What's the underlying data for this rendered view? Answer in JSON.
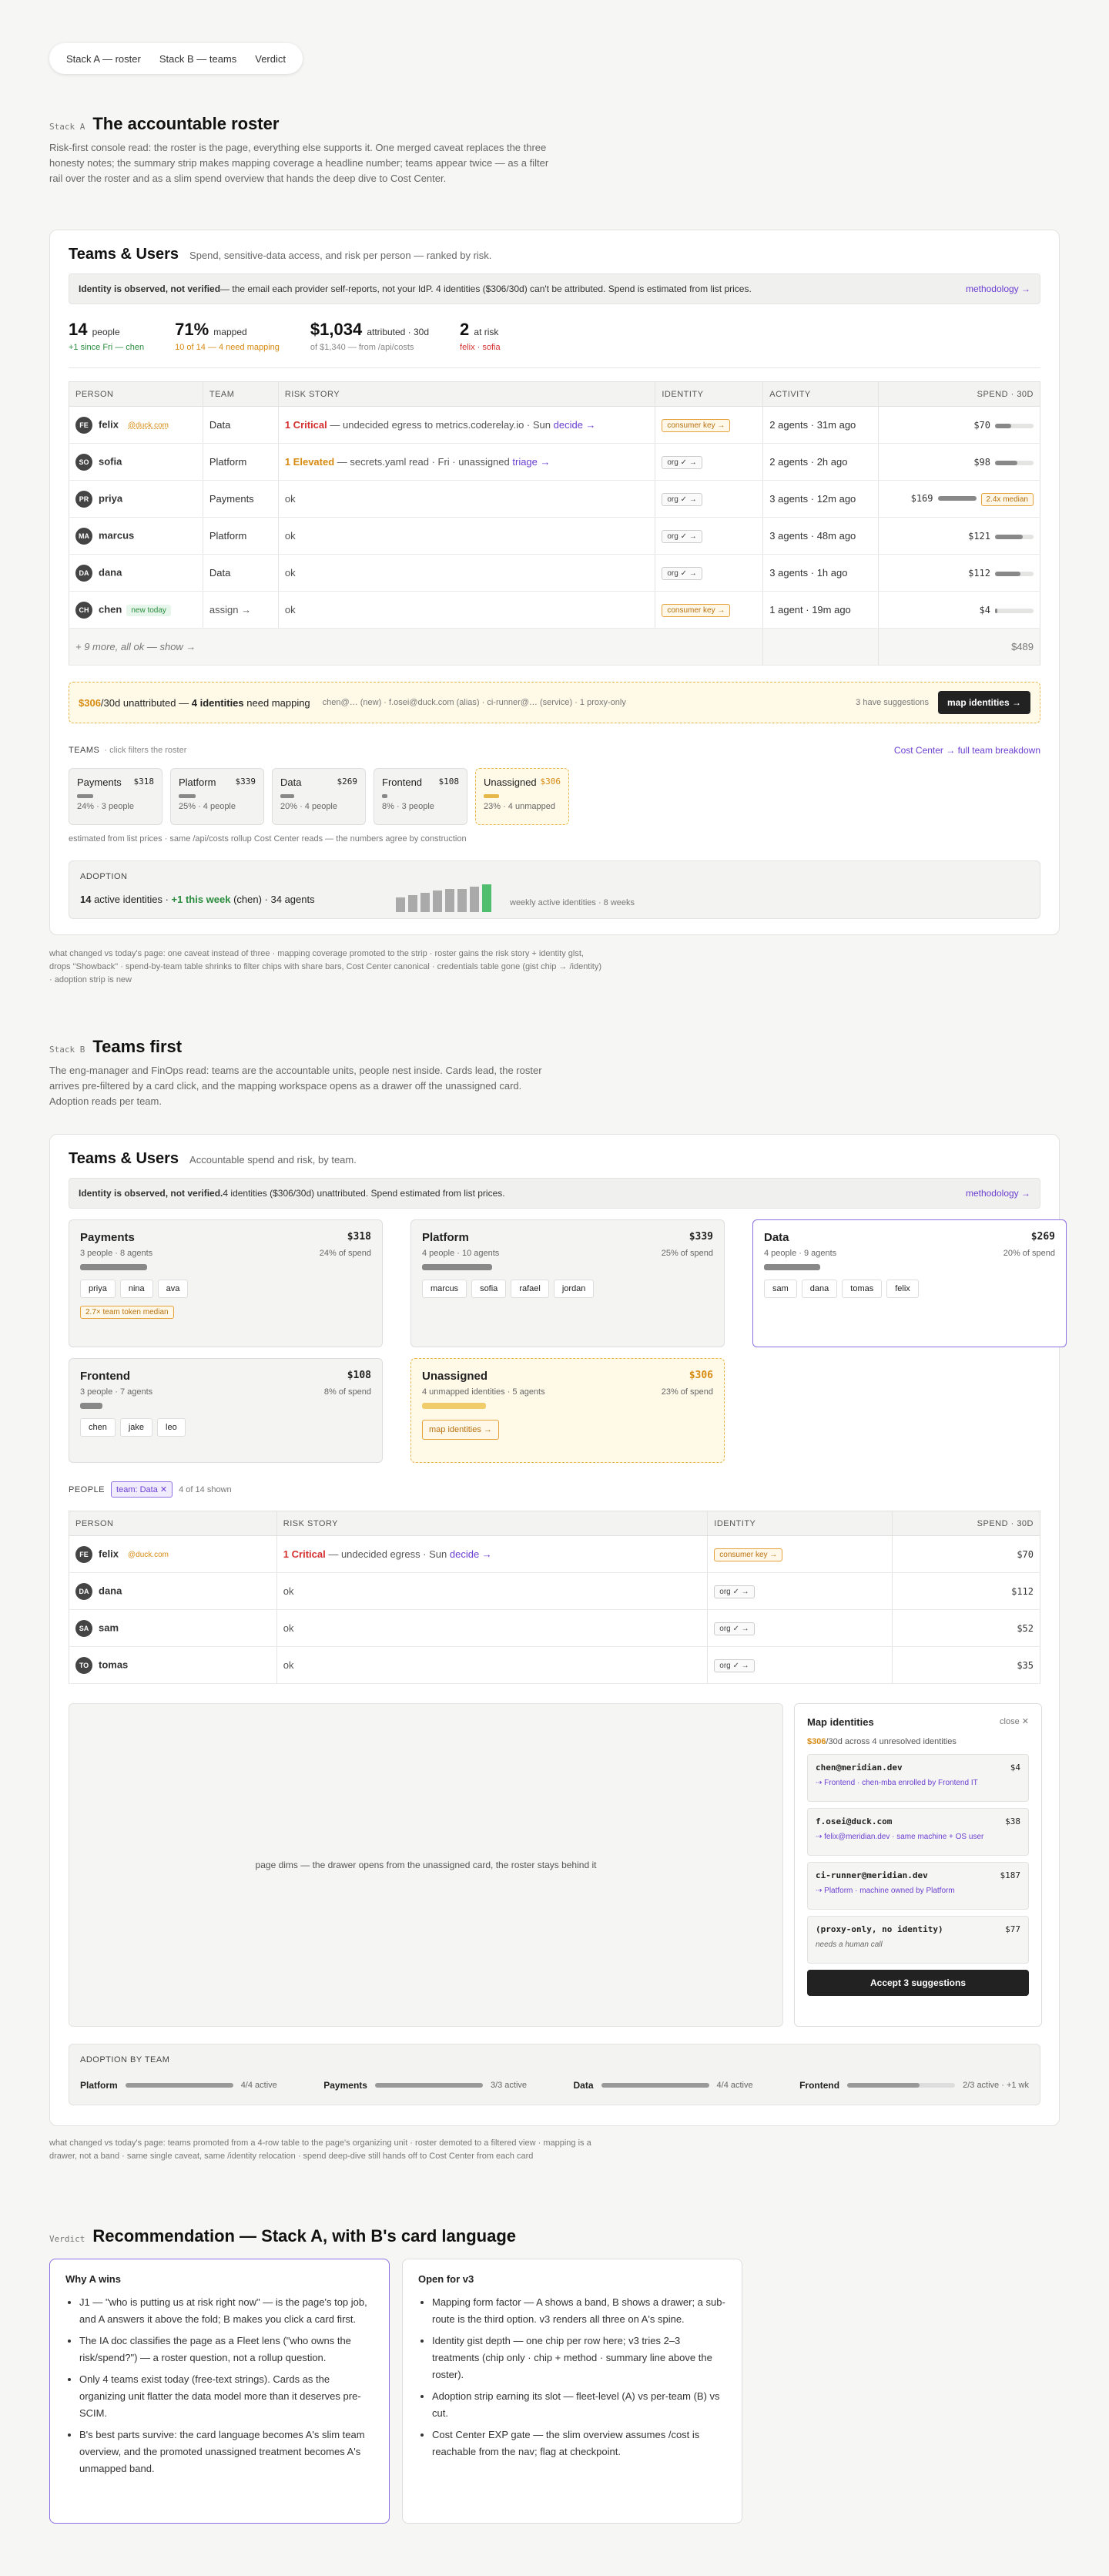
{
  "nav": [
    "Stack A — roster",
    "Stack B — teams",
    "Verdict"
  ],
  "secA": {
    "tag": "Stack A",
    "title": "The accountable roster",
    "lead": "Risk-first console read: the roster is the page, everything else supports it. One merged caveat replaces the three honesty notes; the summary strip makes mapping coverage a headline number; teams appear twice — as a filter rail over the roster and as a slim spend overview that hands the deep dive to Cost Center."
  },
  "cardA": {
    "title": "Teams & Users",
    "subtitle": "Spend, sensitive-data access, and risk per person — ranked by risk.",
    "banner_b": "Identity is observed, not verified",
    "banner_t": " — the email each provider self-reports, not your IdP.  4 identities ($306/30d) can't be attributed.  Spend is estimated from list prices.",
    "banner_link": "methodology →",
    "stats": [
      {
        "big": "14",
        "unit": "people",
        "sub": "+1 since Fri — chen",
        "color": "#2a8c3e"
      },
      {
        "big": "71%",
        "unit": "mapped",
        "sub": "10 of 14 — 4 need mapping",
        "color": "#d68a10"
      },
      {
        "big": "$1,034",
        "unit": "attributed · 30d",
        "sub": "of $1,340 — from /api/costs",
        "color": "#888"
      },
      {
        "big": "2",
        "unit": "at risk",
        "sub": "felix · sofia",
        "color": "#d43030"
      }
    ],
    "headers": [
      "PERSON",
      "TEAM",
      "RISK STORY",
      "IDENTITY",
      "ACTIVITY",
      "SPEND · 30D"
    ],
    "rows": [
      {
        "ini": "FE",
        "name": "felix",
        "badge": "@duck.com",
        "team": "Data",
        "sev": "1 Critical",
        "sevc": "sev-c",
        "story": " — undecided egress to metrics.coderelay.io · Sun ",
        "act": "decide →",
        "id": "consumer key →",
        "idc": "chip-warn",
        "activity": "2 agents · 31m ago",
        "spend": "$70",
        "pct": 0.42
      },
      {
        "ini": "SO",
        "name": "sofia",
        "badge": "",
        "team": "Platform",
        "sev": "1 Elevated",
        "sevc": "sev-e",
        "story": " — secrets.yaml read · Fri · unassigned ",
        "act": "triage →",
        "id": "org ✓ →",
        "idc": "chip-org",
        "activity": "2 agents · 2h ago",
        "spend": "$98",
        "pct": 0.58
      },
      {
        "ini": "PR",
        "name": "priya",
        "badge": "",
        "team": "Payments",
        "sev": "",
        "sevc": "",
        "story": "ok",
        "act": "",
        "id": "org ✓ →",
        "idc": "chip-org",
        "activity": "3 agents · 12m ago",
        "spend": "$169",
        "pct": 1,
        "median": "2.4x median"
      },
      {
        "ini": "MA",
        "name": "marcus",
        "badge": "",
        "team": "Platform",
        "sev": "",
        "sevc": "",
        "story": "ok",
        "act": "",
        "id": "org ✓ →",
        "idc": "chip-org",
        "activity": "3 agents · 48m ago",
        "spend": "$121",
        "pct": 0.72
      },
      {
        "ini": "DA",
        "name": "dana",
        "badge": "",
        "team": "Data",
        "sev": "",
        "sevc": "",
        "story": "ok",
        "act": "",
        "id": "org ✓ →",
        "idc": "chip-org",
        "activity": "3 agents · 1h ago",
        "spend": "$112",
        "pct": 0.66
      },
      {
        "ini": "CH",
        "name": "chen",
        "badge": "new today",
        "team": "assign →",
        "sev": "",
        "sevc": "",
        "story": "ok",
        "act": "",
        "id": "consumer key →",
        "idc": "chip-warn",
        "activity": "1 agent · 19m ago",
        "spend": "$4",
        "pct": 0.05
      }
    ],
    "more": "+ 9 more, all ok — show →",
    "more_spend": "$489",
    "unmap_amt": "$306",
    "unmap_t": "/30d unattributed — ",
    "unmap_b": "4 identities",
    "unmap_t2": " need mapping",
    "unmap_list": "chen@… (new) · f.osei@duck.com (alias) · ci-runner@… (service) · 1 proxy-only",
    "unmap_sug": "3 have suggestions",
    "unmap_btn": "map identities →",
    "teams_label": "TEAMS",
    "teams_hint": "· click filters the roster",
    "teams_link": "Cost Center → full team breakdown",
    "teams": [
      {
        "n": "Payments",
        "v": "$318",
        "s": "24% · 3 people",
        "w": 0.24
      },
      {
        "n": "Platform",
        "v": "$339",
        "s": "25% · 4 people",
        "w": 0.25
      },
      {
        "n": "Data",
        "v": "$269",
        "s": "20% · 4 people",
        "w": 0.2
      },
      {
        "n": "Frontend",
        "v": "$108",
        "s": "8% · 3 people",
        "w": 0.08
      },
      {
        "n": "Unassigned",
        "v": "$306",
        "s": "23% · 4 unmapped",
        "w": 0.23
      }
    ],
    "teams_note": "estimated from list prices · same /api/costs rollup Cost Center reads — the numbers agree by construction",
    "adoption_label": "ADOPTION",
    "adoption_a": "14",
    "adoption_b": " active identities · ",
    "adoption_c": "+1 this week",
    "adoption_d": " (chen) · 34 agents",
    "adoption_weeks": [
      7,
      8,
      9,
      10,
      11,
      11,
      12,
      13
    ],
    "adoption_cap": "weekly active identities · 8 weeks"
  },
  "noteA": "what changed vs today's page: one caveat instead of three · mapping coverage promoted to the strip · roster gains the risk story + identity glst, drops \"Showback\" · spend-by-team table shrinks to filter chips with share bars, Cost Center canonical · credentials table gone (gist chip → /identity) · adoption strip is new",
  "secB": {
    "tag": "Stack B",
    "title": "Teams first",
    "lead": "The eng-manager and FinOps read: teams are the accountable units, people nest inside. Cards lead, the roster arrives pre-filtered by a card click, and the mapping workspace opens as a drawer off the unassigned card. Adoption reads per team."
  },
  "cardB": {
    "title": "Teams & Users",
    "subtitle": "Accountable spend and risk, by team.",
    "banner_b": "Identity is observed, not verified.",
    "banner_t": "  4 identities ($306/30d) unattributed.  Spend estimated from list prices.",
    "banner_link": "methodology →",
    "teams": [
      {
        "n": "Payments",
        "v": "$318",
        "s": "3 people · 8 agents",
        "p": "24% of spend",
        "w": 0.24,
        "people": [
          "priya",
          "nina",
          "ava"
        ],
        "flag": "2.7× team token median"
      },
      {
        "n": "Platform",
        "v": "$339",
        "s": "4 people · 10 agents",
        "p": "25% of spend",
        "w": 0.25,
        "people": [
          "marcus",
          "sofia",
          "rafael",
          "jordan"
        ]
      },
      {
        "n": "Data",
        "v": "$269",
        "s": "4 people · 9 agents",
        "p": "20% of spend",
        "w": 0.2,
        "people": [
          "sam",
          "dana",
          "tomas",
          "felix"
        ]
      },
      {
        "n": "Frontend",
        "v": "$108",
        "s": "3 people · 7 agents",
        "p": "8% of spend",
        "w": 0.08,
        "people": [
          "chen",
          "jake",
          "leo"
        ]
      },
      {
        "n": "Unassigned",
        "v": "$306",
        "s": "4 unmapped identities · 5 agents",
        "p": "23% of spend",
        "w": 0.23,
        "cta": "map identities →"
      }
    ],
    "people_label": "PEOPLE",
    "filter": "team: Data",
    "filter_count": "4 of 14 shown",
    "headers": [
      "PERSON",
      "RISK STORY",
      "IDENTITY",
      "SPEND · 30D"
    ],
    "rows": [
      {
        "ini": "FE",
        "name": "felix",
        "badge": "@duck.com",
        "sev": "1 Critical",
        "story": " — undecided egress · Sun ",
        "act": "decide →",
        "id": "consumer key →",
        "idc": "chip-warn",
        "spend": "$70"
      },
      {
        "ini": "DA",
        "name": "dana",
        "badge": "",
        "sev": "",
        "story": "ok",
        "act": "",
        "id": "org ✓ →",
        "idc": "chip-org",
        "spend": "$112"
      },
      {
        "ini": "SA",
        "name": "sam",
        "badge": "",
        "sev": "",
        "story": "ok",
        "act": "",
        "id": "org ✓ →",
        "idc": "chip-org",
        "spend": "$52"
      },
      {
        "ini": "TO",
        "name": "tomas",
        "badge": "",
        "sev": "",
        "story": "ok",
        "act": "",
        "id": "org ✓ →",
        "idc": "chip-org",
        "spend": "$35"
      }
    ],
    "dim_text": "page dims — the drawer opens from the unassigned card, the roster stays behind it",
    "drawer": {
      "title": "Map identities",
      "close": "close ✕",
      "amt": "$306",
      "sub": "/30d across 4 unresolved identities",
      "items": [
        {
          "id": "chen@meridian.dev",
          "v": "$4",
          "s": "⇢ Frontend · chen-mba enrolled by Frontend IT"
        },
        {
          "id": "f.osei@duck.com",
          "v": "$38",
          "s": "⇢ felix@meridian.dev · same machine + OS user"
        },
        {
          "id": "ci-runner@meridian.dev",
          "v": "$187",
          "s": "⇢ Platform · machine owned by Platform"
        },
        {
          "id": "(proxy-only, no identity)",
          "v": "$77",
          "s": "needs a human call",
          "gray": true
        }
      ],
      "btn": "Accept 3 suggestions"
    },
    "adopt_label": "ADOPTION BY TEAM",
    "adopt": [
      {
        "n": "Platform",
        "v": "4/4 active",
        "w": 1
      },
      {
        "n": "Payments",
        "v": "3/3 active",
        "w": 1
      },
      {
        "n": "Data",
        "v": "4/4 active",
        "w": 1
      },
      {
        "n": "Frontend",
        "v": "2/3 active · +1 wk",
        "w": 0.67
      }
    ]
  },
  "noteB": "what changed vs today's page: teams promoted from a 4-row table to the page's organizing unit · roster demoted to a filtered view · mapping is a drawer, not a band · same single caveat, same /identity relocation · spend deep-dive still hands off to Cost Center from each card",
  "verdict": {
    "tag": "Verdict",
    "title": "Recommendation — Stack A, with B's card language",
    "why_title": "Why A wins",
    "why": [
      "J1 — \"who is putting us at risk right now\" — is the page's top job, and A answers it above the fold; B makes you click a card first.",
      "The IA doc classifies the page as a Fleet lens (\"who owns the risk/spend?\") — a roster question, not a rollup question.",
      "Only 4 teams exist today (free-text strings). Cards as the organizing unit flatter the data model more than it deserves pre-SCIM.",
      "B's best parts survive: the card language becomes A's slim team overview, and the promoted unassigned treatment becomes A's unmapped band."
    ],
    "open_title": "Open for v3",
    "open": [
      "Mapping form factor — A shows a band, B shows a drawer; a sub-route is the third option. v3 renders all three on A's spine.",
      "Identity gist depth — one chip per row here; v3 tries 2–3 treatments (chip only · chip + method · summary line above the roster).",
      "Adoption strip earning its slot — fleet-level (A) vs per-team (B) vs cut.",
      "Cost Center EXP gate — the slim overview assumes /cost is reachable from the nav; flag at checkpoint."
    ]
  }
}
